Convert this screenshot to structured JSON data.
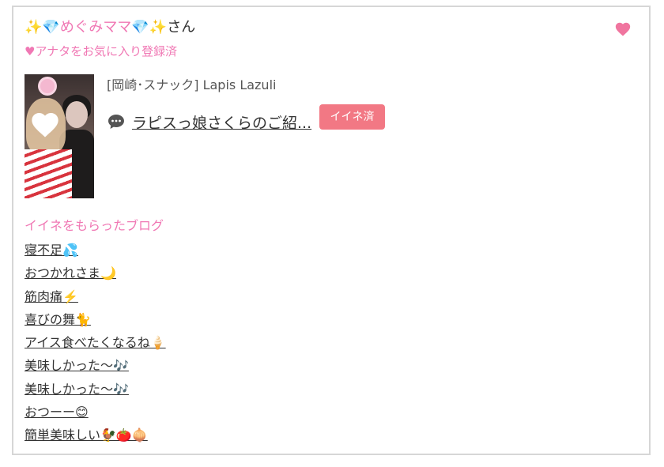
{
  "user": {
    "name": "✨💎めぐみママ💎✨",
    "suffix": "さん",
    "favorite_status": "♥アナタをお気に入り登録済"
  },
  "icons": {
    "favorite": "heart-icon",
    "comment": "chat-bubble-icon"
  },
  "colors": {
    "accent_pink": "#f078b4",
    "badge_bg": "#f27884",
    "heart": "#f0759f",
    "text": "#333333"
  },
  "shop": {
    "label": "[岡崎･スナック]  Lapis Lazuli"
  },
  "blog": {
    "title": "ラピスっ娘さくらのご紹...",
    "badge": "イイネ済"
  },
  "liked_section": {
    "title": "イイネをもらったブログ",
    "items": [
      "寝不足💦",
      "おつかれさま🌙",
      "筋肉痛⚡️",
      "喜びの舞🐈",
      "アイス食べたくなるね🍦",
      "美味しかった〜🎶",
      "美味しかった〜🎶",
      "おつーー😊",
      "簡単美味しい🐓🍅🧅"
    ]
  }
}
